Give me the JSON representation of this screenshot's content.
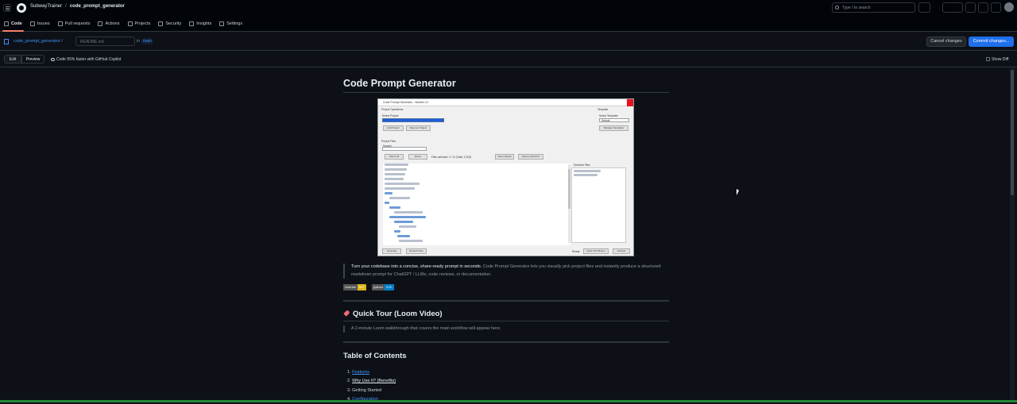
{
  "header": {
    "owner": "SubwayTrainer",
    "repo": "code_prompt_generator",
    "search_placeholder": "Type / to search",
    "tabs": [
      {
        "label": "Code",
        "icon": "code-icon"
      },
      {
        "label": "Issues",
        "icon": "issue-icon"
      },
      {
        "label": "Pull requests",
        "icon": "pull-request-icon"
      },
      {
        "label": "Actions",
        "icon": "actions-icon"
      },
      {
        "label": "Projects",
        "icon": "projects-icon"
      },
      {
        "label": "Security",
        "icon": "shield-icon"
      },
      {
        "label": "Insights",
        "icon": "graph-icon"
      },
      {
        "label": "Settings",
        "icon": "gear-icon"
      }
    ]
  },
  "editor": {
    "path_repo": "code_prompt_generator",
    "path_sep": "/",
    "filename_value": "README.md",
    "in_label": "in",
    "branch": "main",
    "cancel_label": "Cancel changes",
    "commit_label": "Commit changes..."
  },
  "modebar": {
    "edit_label": "Edit",
    "preview_label": "Preview",
    "copilot_label": "Code 55% faster with GitHub Copilot",
    "show_diff_label": "Show Diff"
  },
  "article": {
    "title": "Code Prompt Generator",
    "screenshot": {
      "window_title": "Code Prompt Generator - Modern UI",
      "project_label": "Project Operations",
      "select_project_label": "Select Project:",
      "add_project": "Add Project",
      "remove_project": "Remove Project",
      "template_label": "Template",
      "select_template_label": "Select Template:",
      "template_value": "Default",
      "manage_templates": "Manage Templates",
      "project_files_label": "Project Files",
      "search_label": "Search:",
      "select_all": "Select All",
      "reset": "Reset",
      "files_selected": "Files selected: 2 / 11 (Total: 2,103)",
      "view_outputs": "View Outputs",
      "history_selection": "History Selection",
      "selected_files_label": "Selected Files",
      "generate": "Generate",
      "refresh_files": "Refresh Files",
      "ready": "Ready.",
      "quick_text_button": "Quick Text Button",
      "settings": "Settings"
    },
    "intro_bold": "Turn your codebase into a concise, share-ready prompt in seconds.",
    "intro_rest": " Code Prompt Generator lets you visually pick project files and instantly produce a structured markdown prompt for ChatGPT / LLMs, code reviews, or documentation.",
    "badges": [
      {
        "key": "License",
        "value": "MIT",
        "color": "#dfb317"
      },
      {
        "key": "python",
        "value": "3.8+",
        "color": "#007ec6"
      }
    ],
    "quick_tour_title": "Quick Tour (Loom Video)",
    "quick_tour_note": "A 2-minute Loom walkthrough that covers the main workflow will appear here.",
    "toc_title": "Table of Contents",
    "toc": [
      {
        "num": "1.",
        "label": "Features"
      },
      {
        "num": "2.",
        "label": "Why Use It? (Benefits)"
      },
      {
        "num": "3.",
        "label": "Getting Started"
      },
      {
        "num": "4.",
        "label": "Configuration"
      }
    ]
  }
}
